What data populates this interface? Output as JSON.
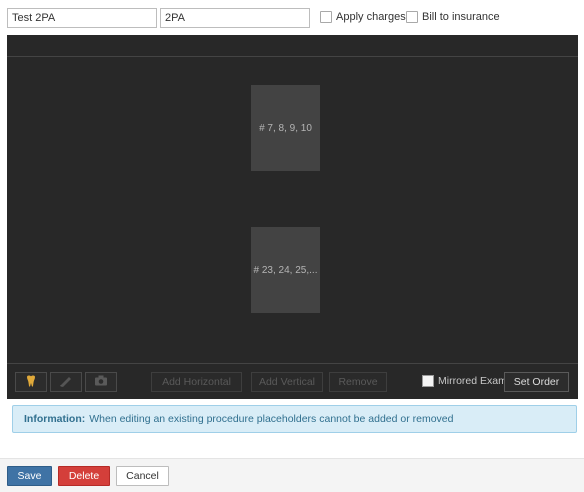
{
  "form": {
    "name_value": "Test 2PA",
    "code_value": "2PA",
    "apply_charges_label": "Apply charges",
    "bill_insurance_label": "Bill to insurance"
  },
  "viewer": {
    "placeholders": [
      {
        "label": "# 7, 8, 9, 10"
      },
      {
        "label": "# 23, 24, 25,..."
      }
    ],
    "toolbar": {
      "icons": [
        "tooth-icon",
        "pen-icon",
        "camera-icon"
      ],
      "add_horizontal_label": "Add Horizontal",
      "add_vertical_label": "Add Vertical",
      "remove_label": "Remove",
      "mirrored_label": "Mirrored Exam",
      "set_order_label": "Set Order"
    }
  },
  "info": {
    "title": "Information:",
    "message": "When editing an existing procedure placeholders cannot be added or removed"
  },
  "footer": {
    "save_label": "Save",
    "delete_label": "Delete",
    "cancel_label": "Cancel"
  },
  "colors": {
    "viewer_bg": "#282828",
    "placeholder_bg": "#434343",
    "info_bg": "#d9edf7",
    "save_bg": "#3f73a5",
    "delete_bg": "#d43f3a"
  }
}
